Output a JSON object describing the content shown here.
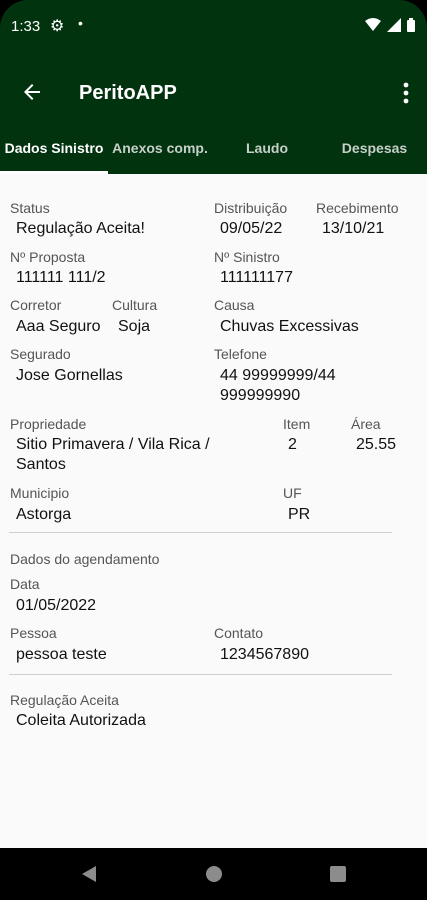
{
  "status_bar": {
    "time": "1:33"
  },
  "app_bar": {
    "title": "PeritoAPP"
  },
  "tabs": [
    {
      "label": "Dados Sinistro",
      "active": true
    },
    {
      "label": "Anexos comp.",
      "active": false
    },
    {
      "label": "Laudo",
      "active": false
    },
    {
      "label": "Despesas",
      "active": false
    }
  ],
  "fields": {
    "status": {
      "label": "Status",
      "value": "Regulação Aceita!"
    },
    "distribuicao": {
      "label": "Distribuição",
      "value": "09/05/22"
    },
    "recebimento": {
      "label": "Recebimento",
      "value": "13/10/21"
    },
    "proposta": {
      "label": "Nº Proposta",
      "value": "111111 111/2"
    },
    "sinistro": {
      "label": "Nº Sinistro",
      "value": "111111177"
    },
    "corretor": {
      "label": "Corretor",
      "value": "Aaa Seguro"
    },
    "cultura": {
      "label": "Cultura",
      "value": "Soja"
    },
    "causa": {
      "label": "Causa",
      "value": "Chuvas Excessivas"
    },
    "segurado": {
      "label": "Segurado",
      "value": "Jose Gornellas"
    },
    "telefone": {
      "label": "Telefone",
      "value_line1": "44 99999999/44",
      "value_line2": "999999990"
    },
    "propriedade": {
      "label": "Propriedade",
      "value_line1": "Sitio Primavera / Vila Rica /",
      "value_line2": "Santos"
    },
    "item": {
      "label": "Item",
      "value": "2"
    },
    "area": {
      "label": "Área",
      "value": "25.55"
    },
    "municipio": {
      "label": "Municipio",
      "value": "Astorga"
    },
    "uf": {
      "label": "UF",
      "value": "PR"
    }
  },
  "agendamento": {
    "section_title": "Dados do agendamento",
    "data": {
      "label": "Data",
      "value": "01/05/2022"
    },
    "pessoa": {
      "label": "Pessoa",
      "value": "pessoa teste"
    },
    "contato": {
      "label": "Contato",
      "value": "1234567890"
    }
  },
  "regulacao": {
    "label": "Regulação Aceita",
    "value": "Coleita Autorizada"
  },
  "colors": {
    "primary": "#02330f",
    "background": "#fafafa",
    "tab_inactive": "#c7cfc9"
  }
}
